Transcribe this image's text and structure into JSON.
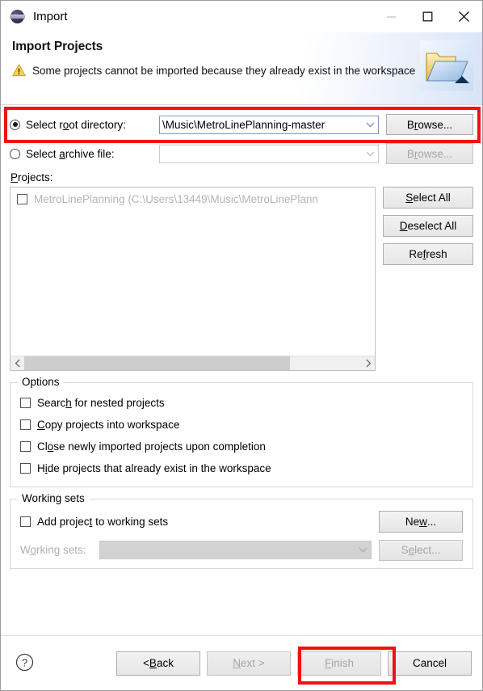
{
  "window": {
    "title": "Import",
    "app_icon": "eclipse-icon",
    "controls": {
      "minimize": "minimize-icon",
      "maximize": "maximize-icon",
      "close": "close-icon"
    }
  },
  "header": {
    "title": "Import Projects",
    "icon": "open-folder-icon",
    "message_icon": "warning-icon",
    "message": "Some projects cannot be imported because they already exist in the workspace"
  },
  "source": {
    "root_directory": {
      "label_pre": "Select r",
      "label_mn": "o",
      "label_post": "ot directory:",
      "label_full": "Select root directory:",
      "selected": true,
      "value": "\\Music\\MetroLinePlanning-master",
      "value_is_selected_text": true,
      "browse_pre": "B",
      "browse_mn": "r",
      "browse_post": "owse...",
      "browse_label": "Browse...",
      "browse_enabled": true,
      "dropdown_icon": "chevron-down-icon"
    },
    "archive_file": {
      "label_pre": "Select ",
      "label_mn": "a",
      "label_post": "rchive file:",
      "label_full": "Select archive file:",
      "selected": false,
      "value": "",
      "browse_pre": "B",
      "browse_mn": "r",
      "browse_post": "owse...",
      "browse_label": "Browse...",
      "browse_enabled": false,
      "dropdown_icon": "chevron-down-icon"
    }
  },
  "projects": {
    "label_pre": "",
    "label_mn": "P",
    "label_post": "rojects:",
    "label_full": "Projects:",
    "items": [
      {
        "text": "MetroLinePlanning (C:\\Users\\13449\\Music\\MetroLinePlann",
        "checked": false,
        "enabled": false
      }
    ],
    "scrollbar": {
      "left_icon": "chevron-left-icon",
      "right_icon": "chevron-right-icon"
    },
    "buttons": [
      {
        "pre": "",
        "mn": "S",
        "post": "elect All",
        "full": "Select All",
        "name": "select-all-button"
      },
      {
        "pre": "",
        "mn": "D",
        "post": "eselect All",
        "full": "Deselect All",
        "name": "deselect-all-button"
      },
      {
        "pre": "Re",
        "mn": "f",
        "post": "resh",
        "full": "Refresh",
        "name": "refresh-button"
      }
    ]
  },
  "options": {
    "title": "Options",
    "items": [
      {
        "pre": "Searc",
        "mn": "h",
        "post": " for nested projects",
        "full": "Search for nested projects",
        "checked": false,
        "name": "option-search-nested"
      },
      {
        "pre": "",
        "mn": "C",
        "post": "opy projects into workspace",
        "full": "Copy projects into workspace",
        "checked": false,
        "name": "option-copy-projects"
      },
      {
        "pre": "Cl",
        "mn": "o",
        "post": "se newly imported projects upon completion",
        "full": "Close newly imported projects upon completion",
        "checked": false,
        "name": "option-close-imported"
      },
      {
        "pre": "H",
        "mn": "i",
        "post": "de projects that already exist in the workspace",
        "full": "Hide projects that already exist in the workspace",
        "checked": false,
        "name": "option-hide-existing"
      }
    ]
  },
  "working_sets": {
    "title": "Working sets",
    "add_checkbox": {
      "pre": "Add projec",
      "mn": "t",
      "post": " to working sets",
      "full": "Add project to working sets",
      "checked": false
    },
    "new_button": {
      "pre": "Ne",
      "mn": "w",
      "post": "...",
      "full": "New...",
      "enabled": true
    },
    "sets_label": {
      "pre": "W",
      "mn": "o",
      "post": "rking sets:",
      "full": "Working sets:",
      "enabled": false
    },
    "sets_value": "",
    "sets_dropdown_icon": "chevron-down-icon",
    "select_button": {
      "pre": "S",
      "mn": "e",
      "post": "lect...",
      "full": "Select...",
      "enabled": false
    }
  },
  "footer": {
    "help_icon": "help-icon",
    "buttons": [
      {
        "pre": "< ",
        "mn": "B",
        "post": "ack",
        "full": "< Back",
        "enabled": true,
        "name": "back-button"
      },
      {
        "pre": "",
        "mn": "N",
        "post": "ext >",
        "full": "Next >",
        "enabled": false,
        "name": "next-button"
      },
      {
        "pre": "",
        "mn": "F",
        "post": "inish",
        "full": "Finish",
        "enabled": false,
        "name": "finish-button"
      },
      {
        "pre": "",
        "mn": "",
        "post": "Cancel",
        "full": "Cancel",
        "enabled": true,
        "name": "cancel-button"
      }
    ]
  },
  "annotations": {
    "accent_color": "#f11111",
    "selection_color": "#2f8ae8",
    "boxes": [
      {
        "name": "highlight-root-directory-row"
      },
      {
        "name": "highlight-finish-button"
      }
    ]
  }
}
